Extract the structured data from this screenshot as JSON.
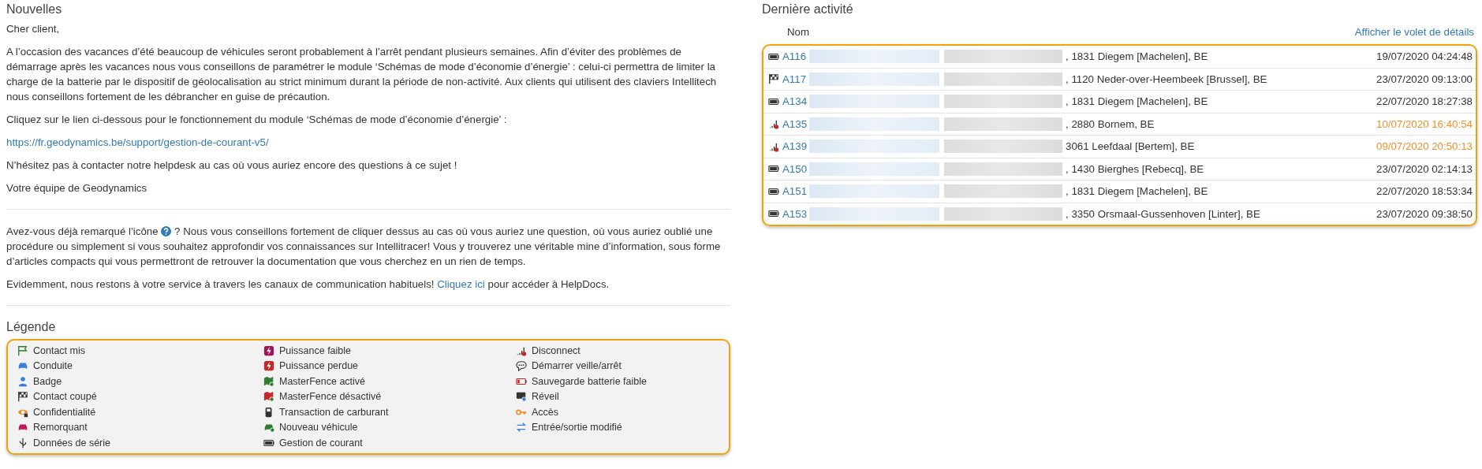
{
  "news": {
    "title": "Nouvelles",
    "greeting": "Cher client,",
    "paragraphs": [
      "A l’occasion des vacances d’été beaucoup de véhicules seront probablement à l’arrêt pendant plusieurs semaines. Afin d’éviter des problèmes de démarrage après les vacances nous vous conseillons de paramétrer le module ‘Schémas de mode d’économie d’énergie’ : celui-ci permettra de limiter la charge de la batterie par le dispositif de géolocalisation au strict minimum durant la période de non-activité. Aux clients qui utilisent des claviers Intellitech nous conseillons fortement de les débrancher en guise de précaution.",
      "Cliquez sur le lien ci-dessous pour le fonctionnement du module ‘Schémas de mode d’économie d’énergie’ :"
    ],
    "link": "https://fr.geodynamics.be/support/gestion-de-courant-v5/",
    "closing": "N’hésitez pas à contacter notre helpdesk au cas où vous auriez encore des questions à ce sujet !",
    "signature": "Votre équipe de Geodynamics",
    "help_before": "Avez-vous déjà remarqué l’icône",
    "help_after": "? Nous vous conseillons fortement de cliquer dessus au cas où vous auriez une question, où vous auriez oublié une procédure ou simplement si vous souhaitez approfondir vos connaissances sur Intellitracer! Vous y trouverez une véritable mine d’information, sous forme d’articles compacts qui vous permettront de retrouver la documentation que vous cherchez en un rien de temps.",
    "service_before": "Evidemment, nous restons à votre service à travers les canaux de communication habituels!",
    "service_link": "Cliquez ici",
    "service_after": "pour accéder à HelpDocs."
  },
  "legend": {
    "title": "Légende",
    "columns": [
      [
        {
          "kind": "flag",
          "label": "Contact mis"
        },
        {
          "kind": "car",
          "label": "Conduite"
        },
        {
          "kind": "person",
          "label": "Badge"
        },
        {
          "kind": "checkered",
          "label": "Contact coupé"
        },
        {
          "kind": "eye",
          "label": "Confidentialité"
        },
        {
          "kind": "tow",
          "label": "Remorquant"
        },
        {
          "kind": "usb",
          "label": "Données de série"
        }
      ],
      [
        {
          "kind": "bolt",
          "label": "Puissance faible"
        },
        {
          "kind": "bolt-red",
          "label": "Puissance perdue"
        },
        {
          "kind": "map",
          "label": "MasterFence activé"
        },
        {
          "kind": "map-red",
          "label": "MasterFence désactivé"
        },
        {
          "kind": "fuel",
          "label": "Transaction de carburant"
        },
        {
          "kind": "car-new",
          "label": "Nouveau véhicule"
        },
        {
          "kind": "battery",
          "label": "Gestion de courant"
        }
      ],
      [
        {
          "kind": "signal",
          "label": "Disconnect"
        },
        {
          "kind": "chat",
          "label": "Démarrer veille/arrêt"
        },
        {
          "kind": "battery-low",
          "label": "Sauvegarde batterie faible"
        },
        {
          "kind": "wake",
          "label": "Réveil"
        },
        {
          "kind": "key",
          "label": "Accès"
        },
        {
          "kind": "arrows",
          "label": "Entrée/sortie modifié"
        }
      ]
    ]
  },
  "activity": {
    "title": "Dernière activité",
    "column": "Nom",
    "details_link": "Afficher le volet de détails",
    "rows": [
      {
        "kind": "battery",
        "id": "A116",
        "address": ", 1831 Diegem [Machelen], BE",
        "time": "19/07/2020 04:24:48",
        "delayed": false
      },
      {
        "kind": "checkered",
        "id": "A117",
        "address": ", 1120 Neder-over-Heembeek [Brussel], BE",
        "time": "23/07/2020 09:13:00",
        "delayed": false
      },
      {
        "kind": "battery",
        "id": "A134",
        "address": ", 1831 Diegem [Machelen], BE",
        "time": "22/07/2020 18:27:38",
        "delayed": false
      },
      {
        "kind": "signal",
        "id": "A135",
        "address": ", 2880 Bornem, BE",
        "time": "10/07/2020 16:40:54",
        "delayed": true
      },
      {
        "kind": "signal",
        "id": "A139",
        "address": "3061 Leefdaal [Bertem], BE",
        "time": "09/07/2020 20:50:13",
        "delayed": true
      },
      {
        "kind": "battery",
        "id": "A150",
        "address": ", 1430 Bierghes [Rebecq], BE",
        "time": "23/07/2020 02:14:13",
        "delayed": false
      },
      {
        "kind": "battery",
        "id": "A151",
        "address": ", 1831 Diegem [Machelen], BE",
        "time": "22/07/2020 18:53:34",
        "delayed": false
      },
      {
        "kind": "battery",
        "id": "A153",
        "address": ", 3350 Orsmaal-Gussenhoven [Linter], BE",
        "time": "23/07/2020 09:38:50",
        "delayed": false
      }
    ]
  }
}
